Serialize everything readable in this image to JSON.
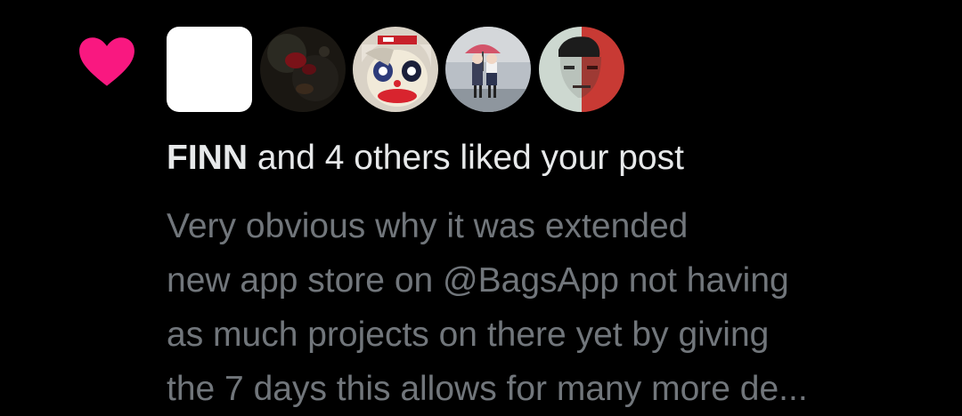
{
  "notification": {
    "type_icon": "heart-icon",
    "accent_color": "#f91880",
    "avatars": [
      {
        "name": "blank-white-avatar"
      },
      {
        "name": "dark-red-abstract-avatar"
      },
      {
        "name": "clown-makeup-avatar"
      },
      {
        "name": "anime-couple-umbrella-avatar"
      },
      {
        "name": "split-face-portrait-avatar"
      }
    ],
    "summary": {
      "user": "FINN",
      "rest": " and 4 others liked your post"
    },
    "post_preview": {
      "lines": [
        "Very obvious why it was extended",
        "new app store on @BagsApp not having",
        "as much projects on there yet by giving",
        "the 7 days this allows for many more de..."
      ]
    }
  }
}
